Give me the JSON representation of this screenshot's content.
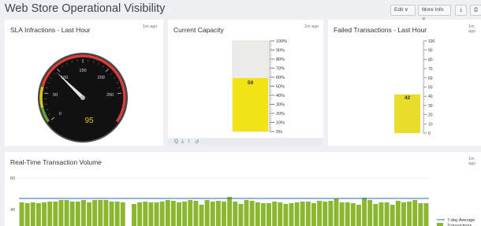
{
  "header": {
    "title": "Web Store Operational Visibility",
    "edit_label": "Edit ∨",
    "more_info_label": "More Info ∨",
    "download_icon_glyph": "⤓",
    "print_icon_glyph": "⎙"
  },
  "panels": {
    "sla": {
      "title": "SLA Infractions - Last Hour",
      "ago": "1m ago",
      "value": "95",
      "needle_value": 95,
      "gauge_min": 0,
      "gauge_max": 300,
      "tick_labels": [
        "0",
        "50",
        "100",
        "150",
        "200",
        "250"
      ],
      "tick_values": [
        0,
        50,
        100,
        150,
        200,
        250
      ],
      "band_colors": {
        "green": "#65a637",
        "yellow": "#d7c81f",
        "red": "#d93f3c"
      }
    },
    "capacity": {
      "title": "Current Capacity",
      "ago": "1m ago",
      "value": "59",
      "fill_percent": 59,
      "tick_labels": [
        "100%",
        "90%",
        "80%",
        "70%",
        "60%",
        "50%",
        "40%",
        "30%",
        "20%",
        "10%",
        "0%"
      ],
      "fill_color": "#f2e316",
      "toolbar_glyphs": [
        "Q",
        "⤓",
        "i",
        "↺"
      ]
    },
    "failed": {
      "title": "Failed Transactions - Last Hour",
      "ago": "1m ago",
      "value": "42",
      "fill_value": 42,
      "axis_max": 100,
      "tick_labels": [
        "100",
        "90",
        "80",
        "70",
        "60",
        "50",
        "40",
        "30",
        "20",
        "10",
        "0"
      ],
      "fill_color": "#e6de2b"
    },
    "volume": {
      "title": "Real-Time Transaction Volume",
      "ago": "1m ago"
    }
  },
  "chart_data": {
    "type": "bar",
    "title": "Real-Time Transaction Volume",
    "ylim": [
      20,
      60
    ],
    "y_ticks": [
      "60",
      "40"
    ],
    "y_tick_values": [
      60,
      40
    ],
    "average_line": 47,
    "average_label": "7-day Average",
    "series": [
      {
        "name": "Transactions",
        "values": [
          44.5,
          44,
          44.5,
          44,
          44.5,
          45,
          45,
          46,
          46,
          45,
          45,
          46,
          44.5,
          46,
          46,
          46,
          45,
          45,
          44.5,
          0,
          43.5,
          44.5,
          45,
          44.5,
          44.5,
          45,
          46,
          45.5,
          44.5,
          45,
          46,
          45.5,
          43,
          46,
          45,
          45.5,
          45,
          48,
          45,
          43.5,
          46,
          45.5,
          44.5,
          44,
          44,
          45,
          44.5,
          43.5,
          44,
          44.5,
          45,
          45,
          44,
          45.5,
          45,
          45.5,
          47,
          44.5,
          44.5,
          44,
          43,
          47.5,
          46,
          43.5,
          44.5,
          44.5,
          43,
          45.5,
          44.5,
          45,
          46,
          44,
          44
        ]
      }
    ],
    "bar_color": "#8bb62f",
    "line_color": "#2d6bb7"
  }
}
